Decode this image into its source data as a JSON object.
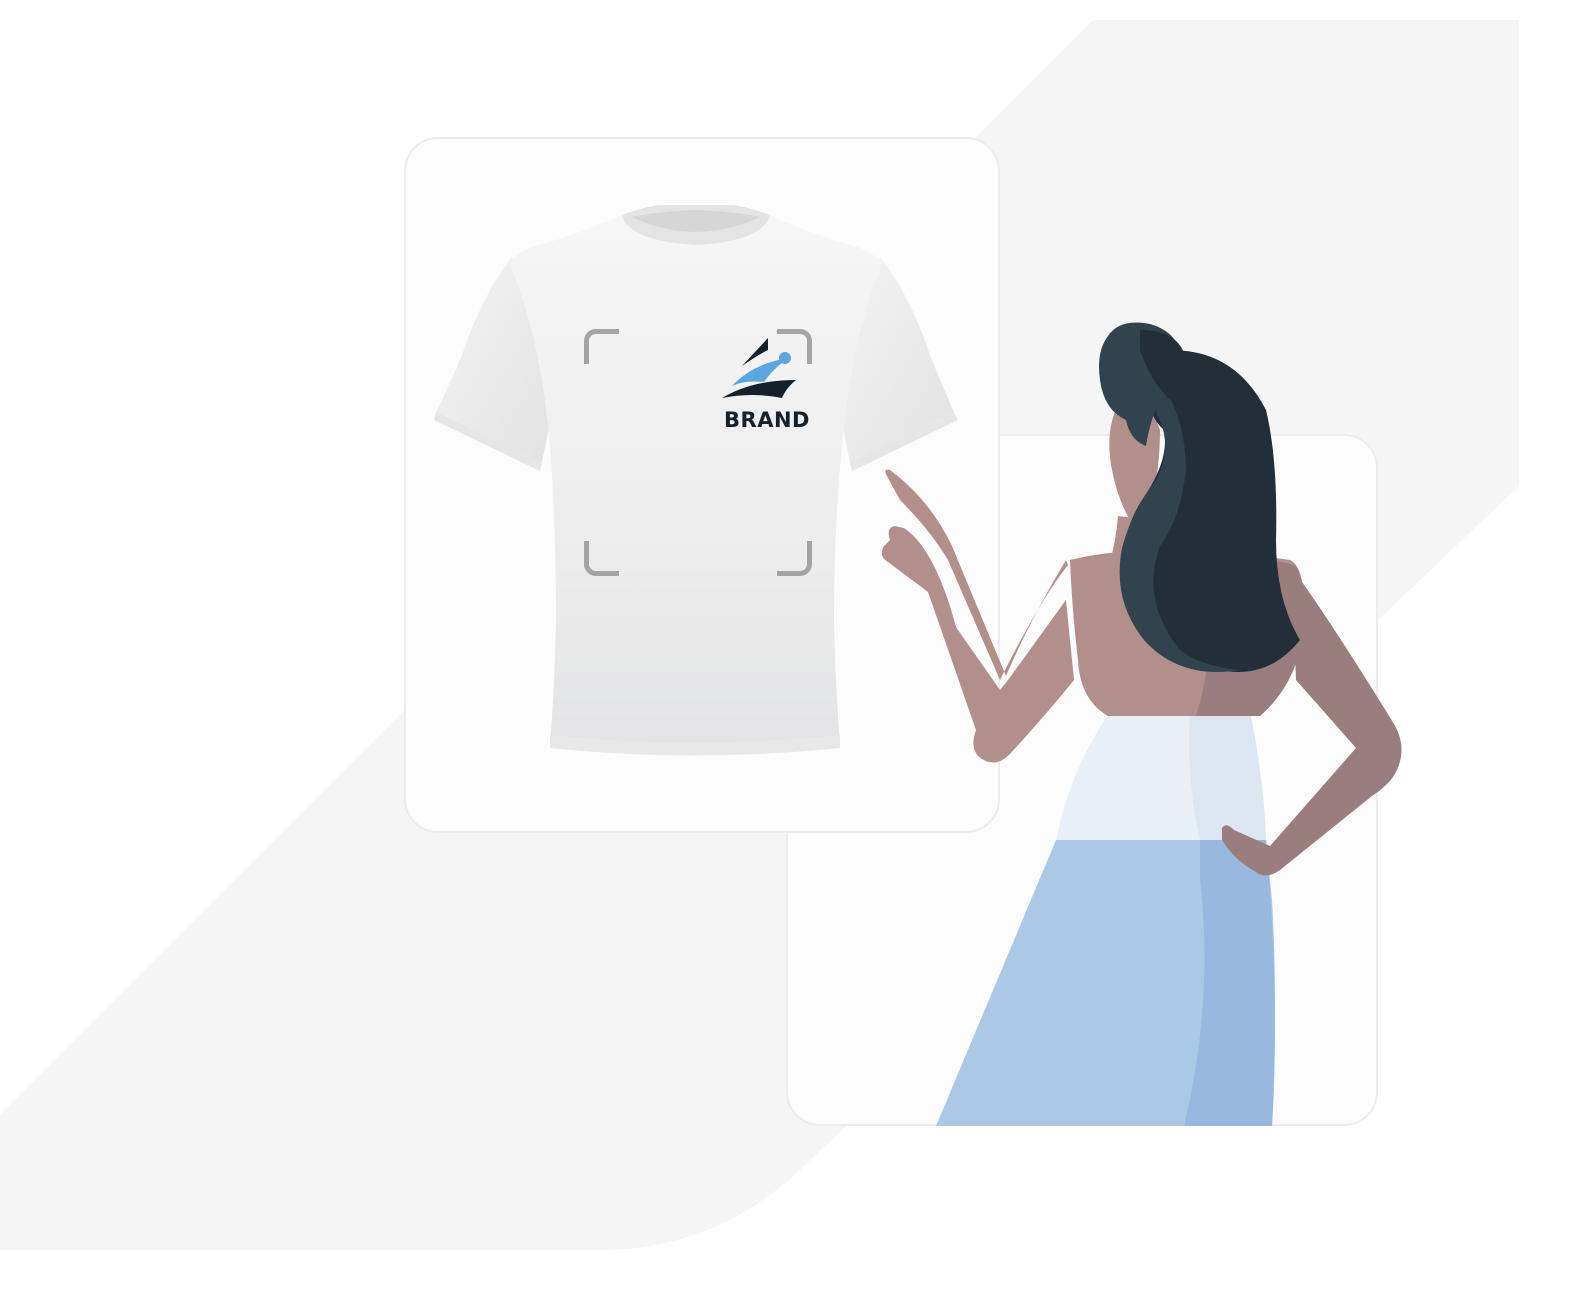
{
  "brand": {
    "text": "BRAND"
  },
  "colors": {
    "background_shape": "#f5f5f5",
    "card_fill": "#fcfcfc",
    "card_border": "#ececec",
    "logo_dark": "#16202c",
    "logo_blue": "#5aa6df",
    "frame_corner": "#a4a4a4",
    "skin": "#b38f8c",
    "skin_shadow": "#9a7e7e",
    "hair_dark": "#222f38",
    "hair_light": "#31434f",
    "skirt": "#abc9e7",
    "skirt_shadow": "#98b8df",
    "top": "#e8eff7"
  },
  "icons": {
    "logo": "brand-logo-icon",
    "shirt": "tshirt-icon",
    "figure": "woman-pointing-illustration"
  }
}
